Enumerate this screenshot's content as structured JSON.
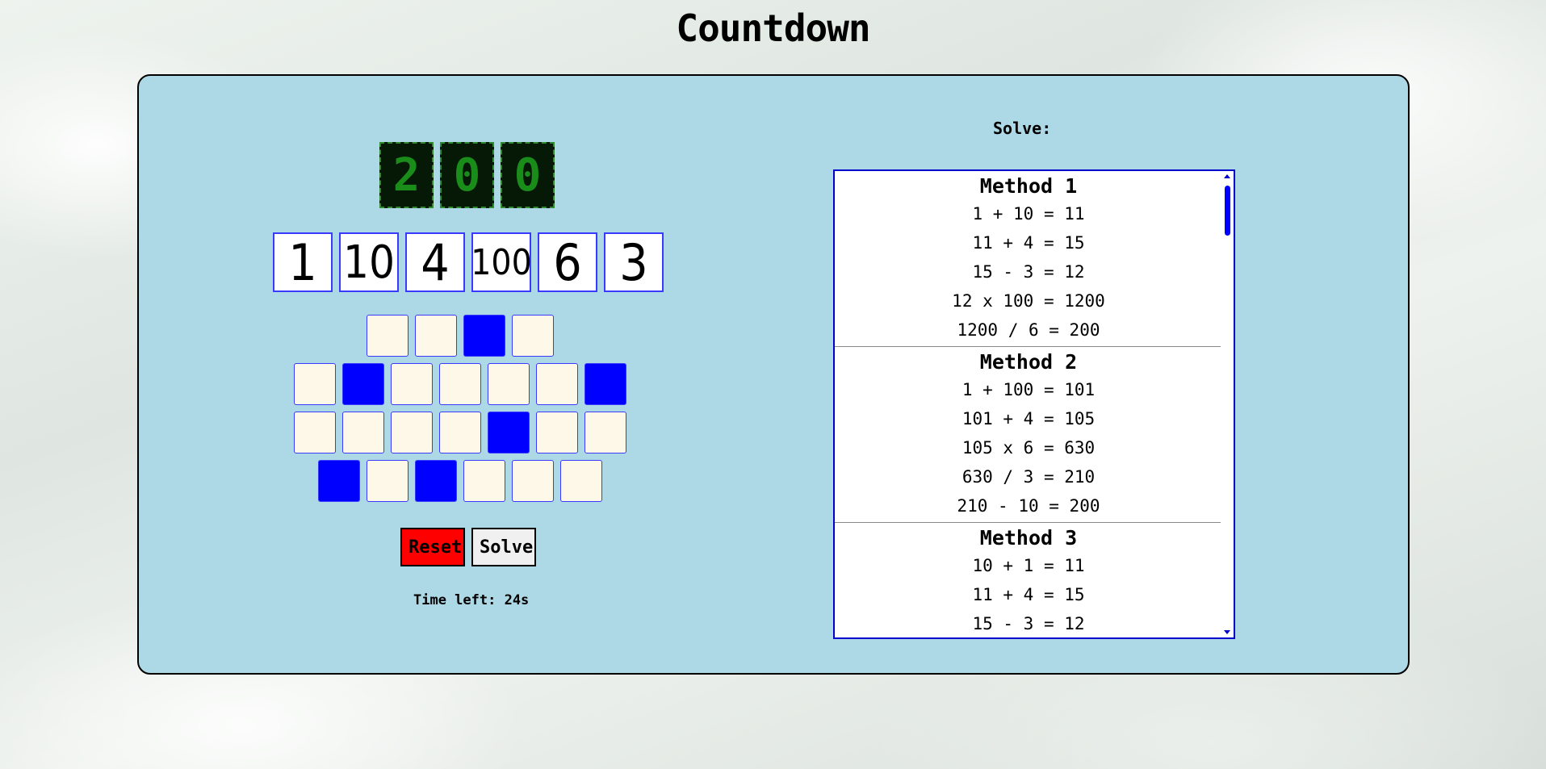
{
  "title": "Countdown",
  "target": [
    "2",
    "0",
    "0"
  ],
  "numbers": [
    "1",
    "10",
    "4",
    "100",
    "6",
    "3"
  ],
  "letter_grid": [
    [
      false,
      false,
      true,
      false
    ],
    [
      false,
      true,
      false,
      false,
      false,
      false,
      true
    ],
    [
      false,
      false,
      false,
      false,
      true,
      false,
      false
    ],
    [
      true,
      false,
      true,
      false,
      false,
      false
    ]
  ],
  "buttons": {
    "reset": "Reset",
    "solve": "Solve"
  },
  "timer": "Time left: 24s",
  "solve_label": "Solve:",
  "methods": [
    {
      "title": "Method 1",
      "steps": [
        "1 + 10 = 11",
        "11 + 4 = 15",
        "15 - 3 = 12",
        "12 x 100 = 1200",
        "1200 / 6 = 200"
      ]
    },
    {
      "title": "Method 2",
      "steps": [
        "1 + 100 = 101",
        "101 + 4 = 105",
        "105 x 6 = 630",
        "630 / 3 = 210",
        "210 - 10 = 200"
      ]
    },
    {
      "title": "Method 3",
      "steps": [
        "10 + 1 = 11",
        "11 + 4 = 15",
        "15 - 3 = 12"
      ]
    }
  ],
  "colors": {
    "panel": "#add8e6",
    "cell_on": "#0000ff",
    "cell_off": "#fdf8e8",
    "reset": "#ff0000",
    "target_digit": "#1a8c1a"
  }
}
